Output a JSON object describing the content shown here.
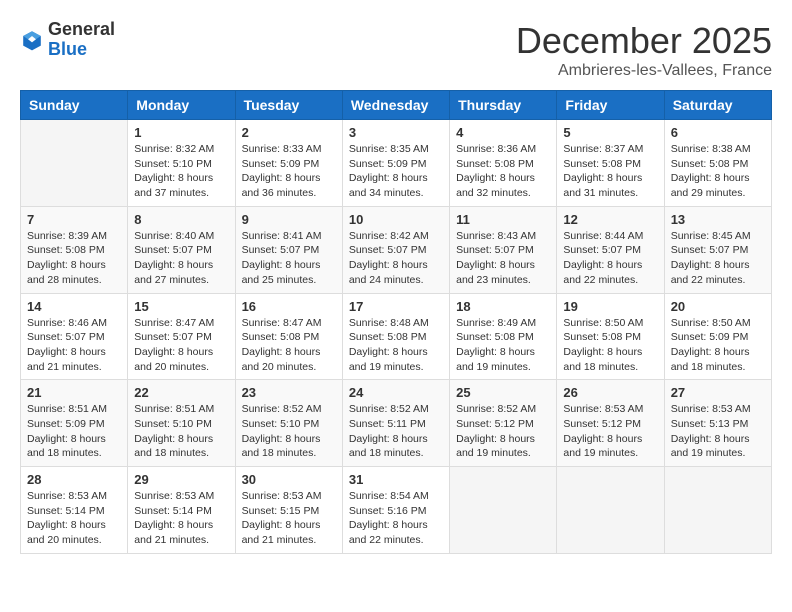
{
  "header": {
    "logo_general": "General",
    "logo_blue": "Blue",
    "month_title": "December 2025",
    "subtitle": "Ambrieres-les-Vallees, France"
  },
  "days_of_week": [
    "Sunday",
    "Monday",
    "Tuesday",
    "Wednesday",
    "Thursday",
    "Friday",
    "Saturday"
  ],
  "weeks": [
    [
      {
        "day": "",
        "info": ""
      },
      {
        "day": "1",
        "info": "Sunrise: 8:32 AM\nSunset: 5:10 PM\nDaylight: 8 hours\nand 37 minutes."
      },
      {
        "day": "2",
        "info": "Sunrise: 8:33 AM\nSunset: 5:09 PM\nDaylight: 8 hours\nand 36 minutes."
      },
      {
        "day": "3",
        "info": "Sunrise: 8:35 AM\nSunset: 5:09 PM\nDaylight: 8 hours\nand 34 minutes."
      },
      {
        "day": "4",
        "info": "Sunrise: 8:36 AM\nSunset: 5:08 PM\nDaylight: 8 hours\nand 32 minutes."
      },
      {
        "day": "5",
        "info": "Sunrise: 8:37 AM\nSunset: 5:08 PM\nDaylight: 8 hours\nand 31 minutes."
      },
      {
        "day": "6",
        "info": "Sunrise: 8:38 AM\nSunset: 5:08 PM\nDaylight: 8 hours\nand 29 minutes."
      }
    ],
    [
      {
        "day": "7",
        "info": "Sunrise: 8:39 AM\nSunset: 5:08 PM\nDaylight: 8 hours\nand 28 minutes."
      },
      {
        "day": "8",
        "info": "Sunrise: 8:40 AM\nSunset: 5:07 PM\nDaylight: 8 hours\nand 27 minutes."
      },
      {
        "day": "9",
        "info": "Sunrise: 8:41 AM\nSunset: 5:07 PM\nDaylight: 8 hours\nand 25 minutes."
      },
      {
        "day": "10",
        "info": "Sunrise: 8:42 AM\nSunset: 5:07 PM\nDaylight: 8 hours\nand 24 minutes."
      },
      {
        "day": "11",
        "info": "Sunrise: 8:43 AM\nSunset: 5:07 PM\nDaylight: 8 hours\nand 23 minutes."
      },
      {
        "day": "12",
        "info": "Sunrise: 8:44 AM\nSunset: 5:07 PM\nDaylight: 8 hours\nand 22 minutes."
      },
      {
        "day": "13",
        "info": "Sunrise: 8:45 AM\nSunset: 5:07 PM\nDaylight: 8 hours\nand 22 minutes."
      }
    ],
    [
      {
        "day": "14",
        "info": "Sunrise: 8:46 AM\nSunset: 5:07 PM\nDaylight: 8 hours\nand 21 minutes."
      },
      {
        "day": "15",
        "info": "Sunrise: 8:47 AM\nSunset: 5:07 PM\nDaylight: 8 hours\nand 20 minutes."
      },
      {
        "day": "16",
        "info": "Sunrise: 8:47 AM\nSunset: 5:08 PM\nDaylight: 8 hours\nand 20 minutes."
      },
      {
        "day": "17",
        "info": "Sunrise: 8:48 AM\nSunset: 5:08 PM\nDaylight: 8 hours\nand 19 minutes."
      },
      {
        "day": "18",
        "info": "Sunrise: 8:49 AM\nSunset: 5:08 PM\nDaylight: 8 hours\nand 19 minutes."
      },
      {
        "day": "19",
        "info": "Sunrise: 8:50 AM\nSunset: 5:08 PM\nDaylight: 8 hours\nand 18 minutes."
      },
      {
        "day": "20",
        "info": "Sunrise: 8:50 AM\nSunset: 5:09 PM\nDaylight: 8 hours\nand 18 minutes."
      }
    ],
    [
      {
        "day": "21",
        "info": "Sunrise: 8:51 AM\nSunset: 5:09 PM\nDaylight: 8 hours\nand 18 minutes."
      },
      {
        "day": "22",
        "info": "Sunrise: 8:51 AM\nSunset: 5:10 PM\nDaylight: 8 hours\nand 18 minutes."
      },
      {
        "day": "23",
        "info": "Sunrise: 8:52 AM\nSunset: 5:10 PM\nDaylight: 8 hours\nand 18 minutes."
      },
      {
        "day": "24",
        "info": "Sunrise: 8:52 AM\nSunset: 5:11 PM\nDaylight: 8 hours\nand 18 minutes."
      },
      {
        "day": "25",
        "info": "Sunrise: 8:52 AM\nSunset: 5:12 PM\nDaylight: 8 hours\nand 19 minutes."
      },
      {
        "day": "26",
        "info": "Sunrise: 8:53 AM\nSunset: 5:12 PM\nDaylight: 8 hours\nand 19 minutes."
      },
      {
        "day": "27",
        "info": "Sunrise: 8:53 AM\nSunset: 5:13 PM\nDaylight: 8 hours\nand 19 minutes."
      }
    ],
    [
      {
        "day": "28",
        "info": "Sunrise: 8:53 AM\nSunset: 5:14 PM\nDaylight: 8 hours\nand 20 minutes."
      },
      {
        "day": "29",
        "info": "Sunrise: 8:53 AM\nSunset: 5:14 PM\nDaylight: 8 hours\nand 21 minutes."
      },
      {
        "day": "30",
        "info": "Sunrise: 8:53 AM\nSunset: 5:15 PM\nDaylight: 8 hours\nand 21 minutes."
      },
      {
        "day": "31",
        "info": "Sunrise: 8:54 AM\nSunset: 5:16 PM\nDaylight: 8 hours\nand 22 minutes."
      },
      {
        "day": "",
        "info": ""
      },
      {
        "day": "",
        "info": ""
      },
      {
        "day": "",
        "info": ""
      }
    ]
  ]
}
